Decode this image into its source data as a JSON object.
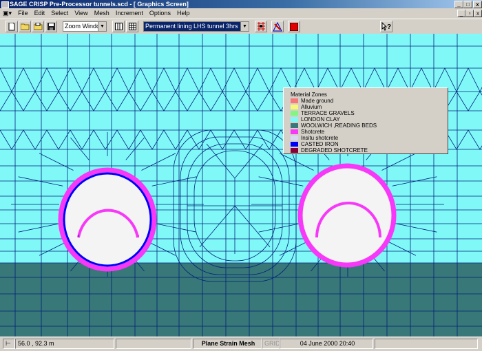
{
  "window": {
    "title": "SAGE CRISP Pre-Processor tunnels.scd - [ Graphics Screen]",
    "minimize": "_",
    "maximize": "□",
    "close": "x"
  },
  "mdi": {
    "minimize": "_",
    "restore": "▫",
    "close": "x"
  },
  "menu": [
    "File",
    "Edit",
    "Select",
    "View",
    "Mesh",
    "Increment",
    "Options",
    "Help"
  ],
  "toolbar": {
    "zoom_mode": "Zoom Window",
    "increment": "Permanent lining LHS tunnel 3hrs",
    "icons": [
      "new-file-icon",
      "open-folder-icon",
      "open-file-icon",
      "save-icon",
      "grid-icon",
      "list-icon",
      "add-points-icon",
      "select-region-icon",
      "materials-icon",
      "help-pointer-icon"
    ]
  },
  "legend": {
    "title": "Material Zones",
    "items": [
      {
        "label": "Made ground",
        "color": "#f87878"
      },
      {
        "label": "Alluvium",
        "color": "#f8f878"
      },
      {
        "label": "TERRACE GRAVELS",
        "color": "#80f880"
      },
      {
        "label": "LONDON CLAY",
        "color": "#80f8f8"
      },
      {
        "label": "WOOLWICH ,READING BEDS",
        "color": "#387878"
      },
      {
        "label": "Shotcrete",
        "color": "#f838f8"
      },
      {
        "label": "Insitu shotcrete",
        "color": "#d8d8f0"
      },
      {
        "label": "CASTED IRON",
        "color": "#0000f8"
      },
      {
        "label": "DEGRADED SHOTCRETE",
        "color": "#880038"
      }
    ]
  },
  "colors": {
    "london_clay": "#80f8f8",
    "woolwich": "#387878",
    "mesh": "#00207a",
    "shotcrete": "#f838f8",
    "cast_iron": "#0000f8",
    "tunnel_void": "#f4f4f4"
  },
  "status": {
    "coords": "56.0 , 92.3 m",
    "mode": "Plane Strain Mesh",
    "grid": "GRID",
    "datetime": "04 June 2000 20:40"
  }
}
